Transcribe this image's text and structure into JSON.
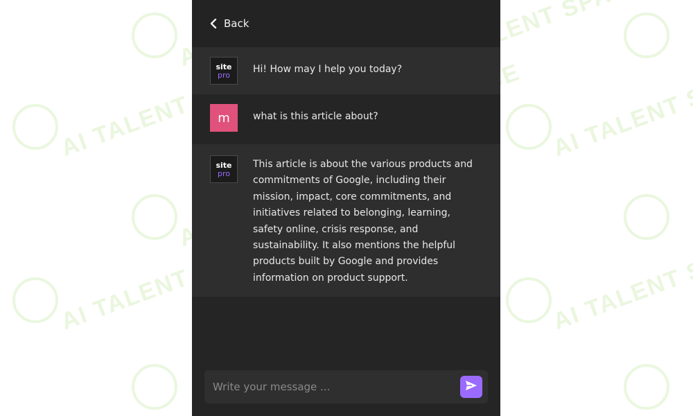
{
  "nav": {
    "back_label": "Back"
  },
  "messages": [
    {
      "sender": "bot",
      "avatar_top": "site",
      "avatar_bottom": "pro",
      "text": "Hi! How may I help you today?"
    },
    {
      "sender": "user",
      "avatar_letter": "m",
      "text": "what is this article about?"
    },
    {
      "sender": "bot",
      "avatar_top": "site",
      "avatar_bottom": "pro",
      "text": "This article is about the various products and commitments of Google, including their mission, impact, core commitments, and initiatives related to belonging, learning, safety online, crisis response, and sustainability. It also mentions the helpful products built by Google and provides information on product support."
    }
  ],
  "composer": {
    "placeholder": "Write your message ..."
  },
  "watermark": {
    "text": "AI TALENT SPACE"
  },
  "colors": {
    "accent": "#9b6bff",
    "user_avatar": "#e0517c",
    "panel": "#252525"
  }
}
